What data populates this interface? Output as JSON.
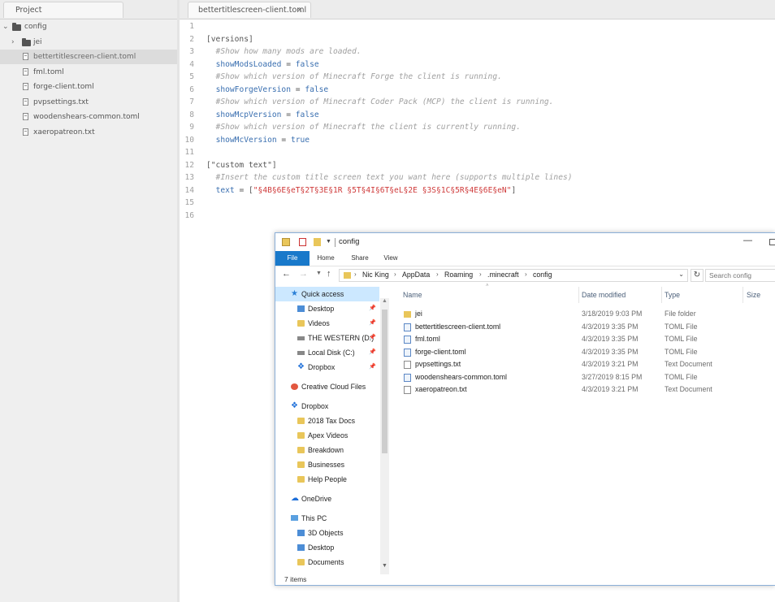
{
  "tree": {
    "tab_label": "Project",
    "root": "config",
    "items": [
      {
        "label": "jei",
        "type": "folder"
      },
      {
        "label": "bettertitlescreen-client.toml",
        "type": "file",
        "selected": true
      },
      {
        "label": "fml.toml",
        "type": "file"
      },
      {
        "label": "forge-client.toml",
        "type": "file"
      },
      {
        "label": "pvpsettings.txt",
        "type": "file"
      },
      {
        "label": "woodenshears-common.toml",
        "type": "file"
      },
      {
        "label": "xaeropatreon.txt",
        "type": "file"
      }
    ]
  },
  "editor": {
    "tab_label": "bettertitlescreen-client.toml",
    "close_glyph": "×",
    "lines": [
      {
        "n": "1",
        "t": ""
      },
      {
        "n": "2",
        "t": "[versions]"
      },
      {
        "n": "3",
        "t": "  #Show how many mods are loaded."
      },
      {
        "n": "4",
        "t": "  showModsLoaded = false"
      },
      {
        "n": "5",
        "t": "  #Show which version of Minecraft Forge the client is running."
      },
      {
        "n": "6",
        "t": "  showForgeVersion = false"
      },
      {
        "n": "7",
        "t": "  #Show which version of Minecraft Coder Pack (MCP) the client is running."
      },
      {
        "n": "8",
        "t": "  showMcpVersion = false"
      },
      {
        "n": "9",
        "t": "  #Show which version of Minecraft the client is currently running."
      },
      {
        "n": "10",
        "t": "  showMcVersion = true"
      },
      {
        "n": "11",
        "t": ""
      },
      {
        "n": "12",
        "t": "[\"custom text\"]"
      },
      {
        "n": "13",
        "t": "  #Insert the custom title screen text you want here (supports multiple lines)"
      },
      {
        "n": "14",
        "t": "  text = [\"§4B§6E§eT§2T§3E§1R §5T§4I§6T§eL§2E §3S§1C§5R§4E§6E§eN\"]"
      },
      {
        "n": "15",
        "t": ""
      },
      {
        "n": "16",
        "t": ""
      }
    ]
  },
  "explorer": {
    "title": "config",
    "minimize_glyph": "—",
    "ribbon_tabs": [
      "File",
      "Home",
      "Share",
      "View"
    ],
    "breadcrumbs": [
      "Nic King",
      "AppData",
      "Roaming",
      ".minecraft",
      "config"
    ],
    "search_placeholder": "Search config",
    "columns": [
      "Name",
      "Date modified",
      "Type",
      "Size"
    ],
    "files": [
      {
        "name": "jei",
        "date": "3/18/2019 9:03 PM",
        "type": "File folder",
        "icon": "folder"
      },
      {
        "name": "bettertitlescreen-client.toml",
        "date": "4/3/2019 3:35 PM",
        "type": "TOML File",
        "icon": "toml"
      },
      {
        "name": "fml.toml",
        "date": "4/3/2019 3:35 PM",
        "type": "TOML File",
        "icon": "toml"
      },
      {
        "name": "forge-client.toml",
        "date": "4/3/2019 3:35 PM",
        "type": "TOML File",
        "icon": "toml"
      },
      {
        "name": "pvpsettings.txt",
        "date": "4/3/2019 3:21 PM",
        "type": "Text Document",
        "icon": "doc"
      },
      {
        "name": "woodenshears-common.toml",
        "date": "3/27/2019 8:15 PM",
        "type": "TOML File",
        "icon": "toml"
      },
      {
        "name": "xaeropatreon.txt",
        "date": "4/3/2019 3:21 PM",
        "type": "Text Document",
        "icon": "doc"
      }
    ],
    "nav": [
      {
        "label": "Quick access",
        "icon": "star-icon",
        "indent": 0,
        "selected": true
      },
      {
        "label": "Desktop",
        "icon": "folder-blue-icon",
        "indent": 1,
        "pinned": true
      },
      {
        "label": "Videos",
        "icon": "folder-icon",
        "indent": 1,
        "pinned": true
      },
      {
        "label": "THE WESTERN (D:)",
        "icon": "drive-icon",
        "indent": 1,
        "pinned": true
      },
      {
        "label": "Local Disk (C:)",
        "icon": "drive-icon",
        "indent": 1,
        "pinned": true
      },
      {
        "label": "Dropbox",
        "icon": "dropbox-icon",
        "indent": 1,
        "pinned": true
      },
      {
        "label": "Creative Cloud Files",
        "icon": "creative-cloud-icon",
        "indent": 0
      },
      {
        "label": "Dropbox",
        "icon": "dropbox-icon",
        "indent": 0
      },
      {
        "label": "2018 Tax Docs",
        "icon": "folder-icon",
        "indent": 1
      },
      {
        "label": "Apex Videos",
        "icon": "folder-icon",
        "indent": 1
      },
      {
        "label": "Breakdown",
        "icon": "folder-icon",
        "indent": 1
      },
      {
        "label": "Businesses",
        "icon": "folder-icon",
        "indent": 1
      },
      {
        "label": "Help People",
        "icon": "folder-icon",
        "indent": 1
      },
      {
        "label": "OneDrive",
        "icon": "onedrive-icon",
        "indent": 0
      },
      {
        "label": "This PC",
        "icon": "pc-icon",
        "indent": 0
      },
      {
        "label": "3D Objects",
        "icon": "folder-blue-icon",
        "indent": 1
      },
      {
        "label": "Desktop",
        "icon": "folder-blue-icon",
        "indent": 1
      },
      {
        "label": "Documents",
        "icon": "folder-icon",
        "indent": 1
      }
    ],
    "status": "7 items"
  }
}
